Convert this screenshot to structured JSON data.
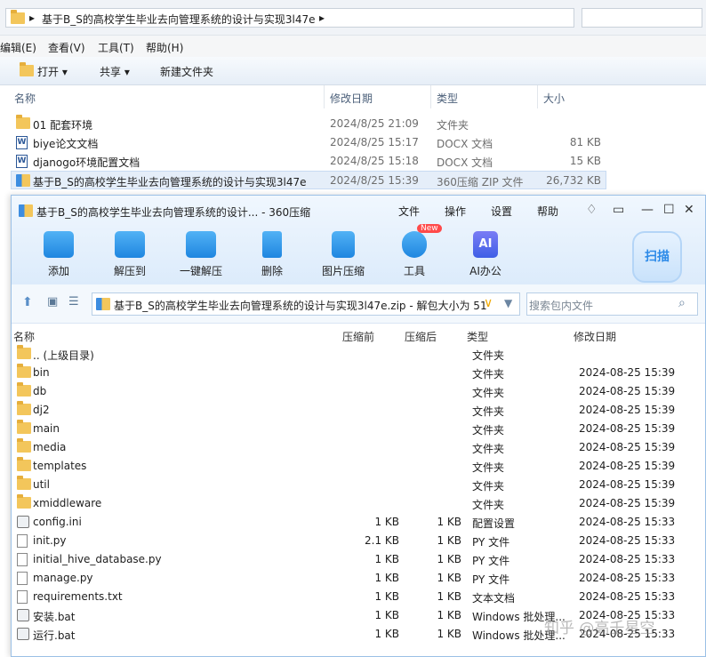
{
  "explorer": {
    "breadcrumb": "基于B_S的高校学生毕业去向管理系统的设计与实现3l47e",
    "menu": [
      "编辑(E)",
      "查看(V)",
      "工具(T)",
      "帮助(H)"
    ],
    "toolbar": {
      "open": "打开",
      "share": "共享",
      "new_folder": "新建文件夹"
    },
    "columns": {
      "name": "名称",
      "date": "修改日期",
      "type": "类型",
      "size": "大小"
    },
    "rows": [
      {
        "name": "01 配套环境",
        "date": "2024/8/25 21:09",
        "type": "文件夹",
        "size": "",
        "icon": "folder-icon"
      },
      {
        "name": "biye论文文档",
        "date": "2024/8/25 15:17",
        "type": "DOCX 文档",
        "size": "81 KB",
        "icon": "word-doc-icon"
      },
      {
        "name": "djanogo环境配置文档",
        "date": "2024/8/25 15:18",
        "type": "DOCX 文档",
        "size": "15 KB",
        "icon": "word-doc-icon"
      },
      {
        "name": "基于B_S的高校学生毕业去向管理系统的设计与实现3l47e",
        "date": "2024/8/25 15:39",
        "type": "360压缩 ZIP 文件",
        "size": "26,732 KB",
        "icon": "zip-archive-icon"
      }
    ]
  },
  "zip": {
    "title": "基于B_S的高校学生毕业去向管理系统的设计... - 360压缩",
    "menu": [
      "文件",
      "操作",
      "设置",
      "帮助"
    ],
    "tools": [
      "添加",
      "解压到",
      "一键解压",
      "删除",
      "图片压缩",
      "工具",
      "AI办公"
    ],
    "new_badge": "New",
    "ai_icon_text": "AI",
    "scan": "扫描",
    "path": "基于B_S的高校学生毕业去向管理系统的设计与实现3l47e.zip - 解包大小为 51",
    "search_placeholder": "搜索包内文件",
    "columns": {
      "name": "名称",
      "packed": "压缩前",
      "unpacked": "压缩后",
      "type": "类型",
      "date": "修改日期"
    },
    "rows": [
      {
        "name": ".. (上级目录)",
        "packed": "",
        "unpacked": "",
        "type": "文件夹",
        "date": "",
        "icon": "folder-icon"
      },
      {
        "name": "bin",
        "packed": "",
        "unpacked": "",
        "type": "文件夹",
        "date": "2024-08-25 15:39",
        "icon": "folder-icon"
      },
      {
        "name": "db",
        "packed": "",
        "unpacked": "",
        "type": "文件夹",
        "date": "2024-08-25 15:39",
        "icon": "folder-icon"
      },
      {
        "name": "dj2",
        "packed": "",
        "unpacked": "",
        "type": "文件夹",
        "date": "2024-08-25 15:39",
        "icon": "folder-icon"
      },
      {
        "name": "main",
        "packed": "",
        "unpacked": "",
        "type": "文件夹",
        "date": "2024-08-25 15:39",
        "icon": "folder-icon"
      },
      {
        "name": "media",
        "packed": "",
        "unpacked": "",
        "type": "文件夹",
        "date": "2024-08-25 15:39",
        "icon": "folder-icon"
      },
      {
        "name": "templates",
        "packed": "",
        "unpacked": "",
        "type": "文件夹",
        "date": "2024-08-25 15:39",
        "icon": "folder-icon"
      },
      {
        "name": "util",
        "packed": "",
        "unpacked": "",
        "type": "文件夹",
        "date": "2024-08-25 15:39",
        "icon": "folder-icon"
      },
      {
        "name": "xmiddleware",
        "packed": "",
        "unpacked": "",
        "type": "文件夹",
        "date": "2024-08-25 15:39",
        "icon": "folder-icon"
      },
      {
        "name": "config.ini",
        "packed": "1 KB",
        "unpacked": "1 KB",
        "type": "配置设置",
        "date": "2024-08-25 15:33",
        "icon": "config-file-icon"
      },
      {
        "name": "init.py",
        "packed": "2.1 KB",
        "unpacked": "1 KB",
        "type": "PY 文件",
        "date": "2024-08-25 15:33",
        "icon": "file-icon"
      },
      {
        "name": "initial_hive_database.py",
        "packed": "1 KB",
        "unpacked": "1 KB",
        "type": "PY 文件",
        "date": "2024-08-25 15:33",
        "icon": "file-icon"
      },
      {
        "name": "manage.py",
        "packed": "1 KB",
        "unpacked": "1 KB",
        "type": "PY 文件",
        "date": "2024-08-25 15:33",
        "icon": "file-icon"
      },
      {
        "name": "requirements.txt",
        "packed": "1 KB",
        "unpacked": "1 KB",
        "type": "文本文档",
        "date": "2024-08-25 15:33",
        "icon": "file-icon"
      },
      {
        "name": "安装.bat",
        "packed": "1 KB",
        "unpacked": "1 KB",
        "type": "Windows 批处理...",
        "date": "2024-08-25 15:33",
        "icon": "bat-file-icon"
      },
      {
        "name": "运行.bat",
        "packed": "1 KB",
        "unpacked": "1 KB",
        "type": "Windows 批处理...",
        "date": "2024-08-25 15:33",
        "icon": "bat-file-icon"
      }
    ]
  },
  "watermark": "知乎 @高壬星空"
}
